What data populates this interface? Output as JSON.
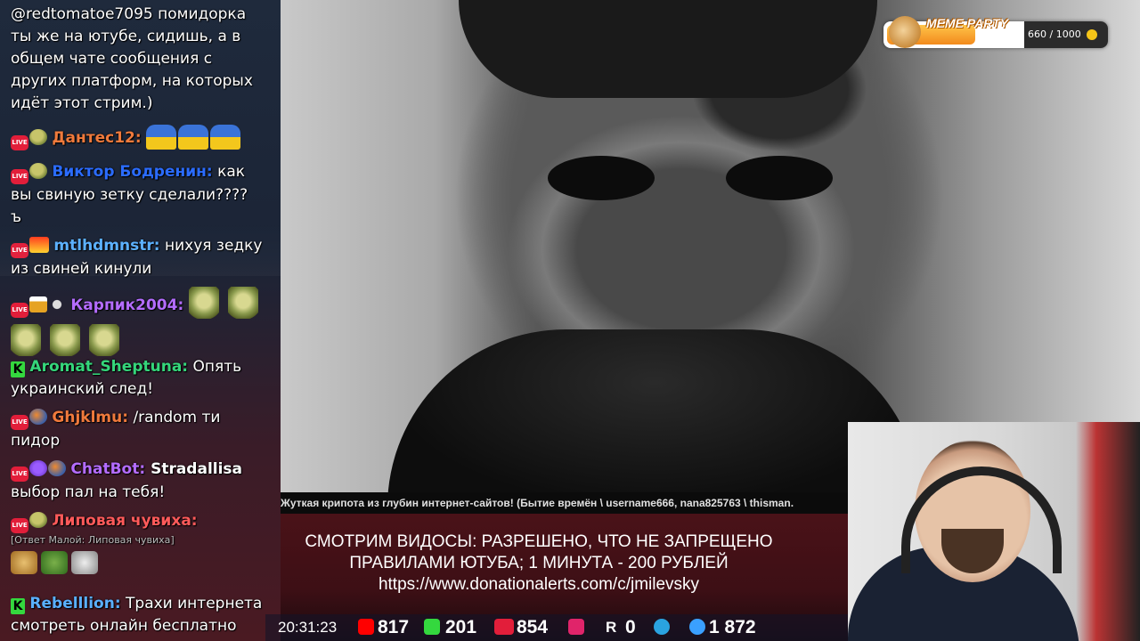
{
  "chat": {
    "m0": {
      "l1": "@redtomatoe7095 помидорка",
      "l2": "ты же на ютубе, сидишь, а в",
      "l3": "общем чате сообщения с",
      "l4": "других платформ, на которых",
      "l5": "идёт этот стрим.)"
    },
    "m1": {
      "user": "Дантес12:",
      "color": "#f07a3c"
    },
    "m2": {
      "user": "Виктор Бодренин:",
      "text": " как",
      "l2": "вы свиную зетку сделали????",
      "l3": "ъ",
      "color": "#2b6cff"
    },
    "m3": {
      "user": "mtlhdmnstr:",
      "text": " нихуя зедку",
      "l2": "из свиней кинули",
      "color": "#5ab0ff"
    },
    "m4": {
      "user": "Карпик2004:",
      "color": "#b46cff"
    },
    "m5": {
      "user": "Aromat_Sheptuna:",
      "text": " Опять",
      "l2": "украинский след!",
      "color": "#35d67b"
    },
    "m6": {
      "user": "Ghjklmu:",
      "text": " /random ти",
      "l2": "пидор",
      "color": "#f07a3c"
    },
    "m7": {
      "user": "ChatBot:",
      "text": " Stradallisa",
      "l2": "выбор пал на тебя!",
      "color": "#b46cff"
    },
    "m8": {
      "user": "Липовая чувиха:",
      "reply": "[Ответ Малой: Липовая чувиха]",
      "color": "#ff5a5a"
    },
    "m9": {
      "user": "Rebelllion:",
      "text": " Трахи интернета",
      "l2": "смотреть онлайн бесплатно",
      "color": "#5ab0ff"
    },
    "live_badge": "LIVE",
    "kick_badge": "K"
  },
  "caption": "Жуткая крипота из глубин интернет-сайтов! (Бытие времён \\ username666, nana825763 \\ thisman.",
  "rules": {
    "l1": "СМОТРИМ ВИДОСЫ: РАЗРЕШЕНО, ЧТО НЕ ЗАПРЕЩЕНО",
    "l2": "ПРАВИЛАМИ ЮТУБА; 1 МИНУТА - 200 РУБЛЕЙ",
    "l3": "https://www.donationalerts.com/c/jmilevsky"
  },
  "stats": {
    "time": "20:31:23",
    "youtube": "817",
    "kick": "201",
    "vk_live": "854",
    "rutube": "0",
    "telegram": "",
    "total": "1 872",
    "r_label": "R"
  },
  "meme_party": {
    "title": "MEME PARTY",
    "value": "660 / 1000",
    "progress": 0.66
  }
}
